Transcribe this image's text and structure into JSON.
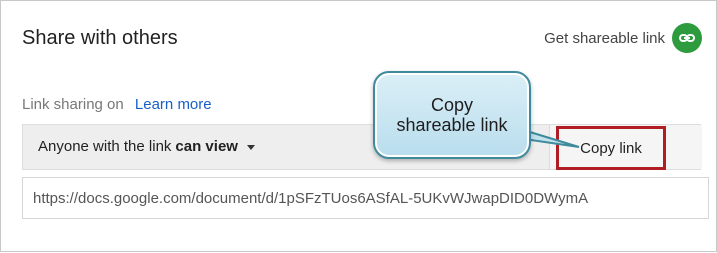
{
  "dialog": {
    "title": "Share with others",
    "get_link_label": "Get shareable link",
    "status_text": "Link sharing on",
    "learn_more_label": "Learn more",
    "access_prefix": "Anyone with the link",
    "access_level": "can view",
    "copy_link_label": "Copy link",
    "url_value": "https://docs.google.com/document/d/1pSFzTUos6ASfAL-5UKvWJwapDID0DWymA"
  },
  "callout": {
    "line1": "Copy",
    "line2": "shareable link"
  },
  "icons": {
    "get_link_icon": "link-icon",
    "dropdown_icon": "chevron-down-icon"
  },
  "colors": {
    "accent_green": "#2e9b3f",
    "link_blue": "#1a5fc8",
    "highlight_red": "#b01e24",
    "callout_fill": "#cbe7f3",
    "callout_border": "#3f8a9b"
  }
}
